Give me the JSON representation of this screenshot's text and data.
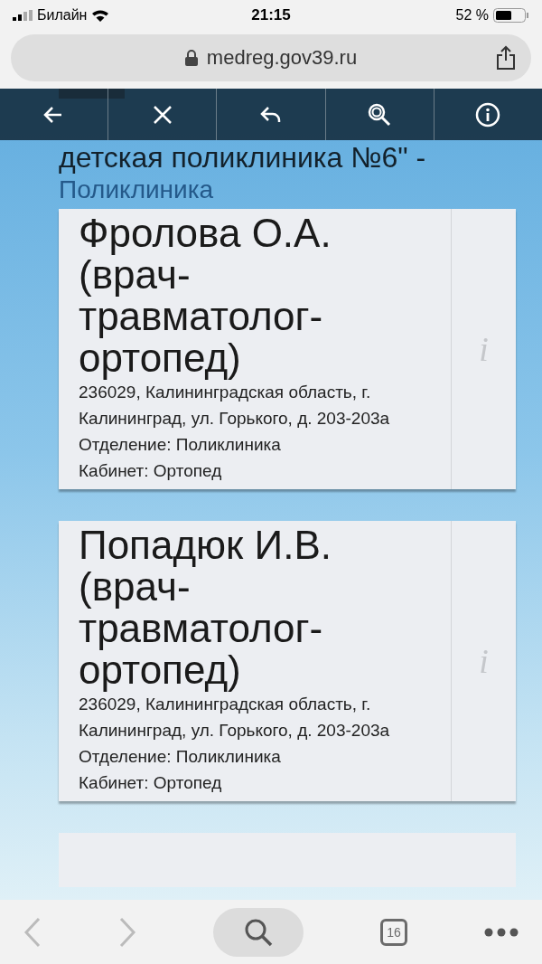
{
  "status_bar": {
    "carrier": "Билайн",
    "time": "21:15",
    "battery": "52 %"
  },
  "address_bar": {
    "url": "medreg.gov39.ru"
  },
  "page": {
    "heading": "детская поликлиника №6\" -",
    "section": "Поликлиника",
    "doctors": [
      {
        "name": "Фролова О.А. (врач-травматолог-ортопед)",
        "address": "236029, Калининградская область, г. Калининград, ул. Горького, д. 203-203а",
        "department": "Отделение: Поликлиника",
        "room": "Кабинет: Ортопед",
        "info": "i"
      },
      {
        "name": "Попадюк И.В. (врач-травматолог-ортопед)",
        "address": "236029, Калининградская область, г. Калининград, ул. Горького, д. 203-203а",
        "department": "Отделение: Поликлиника",
        "room": "Кабинет: Ортопед",
        "info": "i"
      }
    ]
  },
  "bottom_toolbar": {
    "tabs_count": "16"
  }
}
